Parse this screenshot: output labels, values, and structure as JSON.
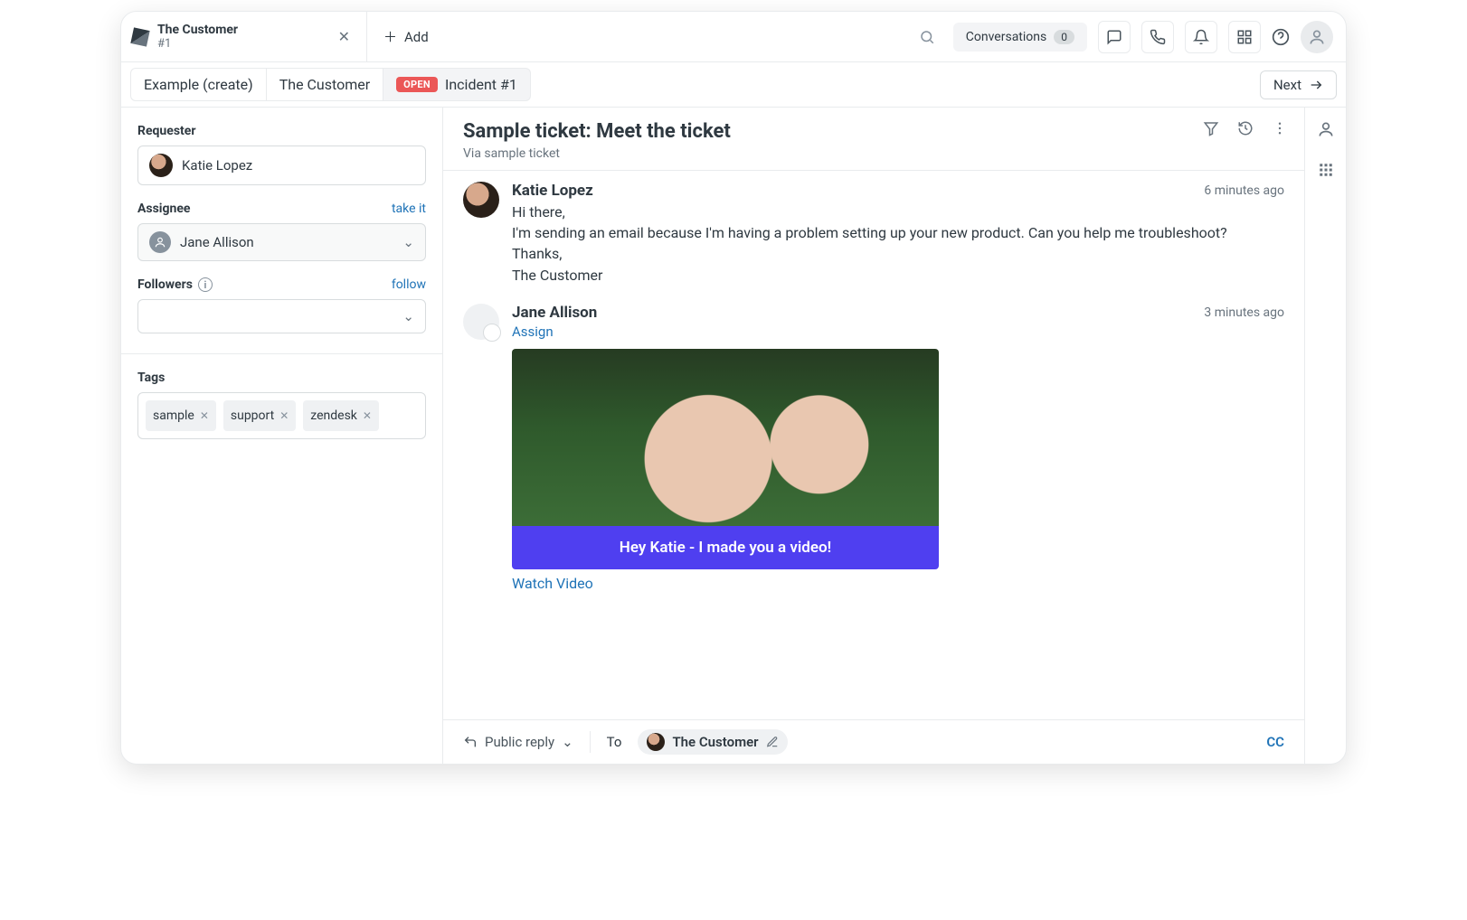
{
  "topbar": {
    "tab": {
      "title": "The Customer",
      "subtitle": "#1"
    },
    "add_label": "Add",
    "conversations": {
      "label": "Conversations",
      "count": "0"
    }
  },
  "breadcrumb": {
    "items": [
      "Example (create)",
      "The Customer"
    ],
    "badge": "OPEN",
    "active": "Incident #1",
    "next": "Next"
  },
  "sidebar": {
    "requester": {
      "label": "Requester",
      "value": "Katie Lopez"
    },
    "assignee": {
      "label": "Assignee",
      "action": "take it",
      "value": "Jane Allison"
    },
    "followers": {
      "label": "Followers",
      "action": "follow"
    },
    "tags": {
      "label": "Tags",
      "items": [
        "sample",
        "support",
        "zendesk"
      ]
    }
  },
  "ticket": {
    "title": "Sample ticket: Meet the ticket",
    "via": "Via sample ticket"
  },
  "messages": [
    {
      "author": "Katie Lopez",
      "time": "6 minutes ago",
      "text": "Hi there,\nI'm sending an email because I'm having a problem setting up your new product. Can you help me troubleshoot?\nThanks,\nThe Customer"
    },
    {
      "author": "Jane Allison",
      "time": "3 minutes ago",
      "assign": "Assign",
      "video_caption": "Hey Katie - I made you a video!",
      "watch": "Watch Video"
    }
  ],
  "compose": {
    "reply_mode": "Public reply",
    "to_label": "To",
    "to_value": "The Customer",
    "cc": "CC"
  }
}
